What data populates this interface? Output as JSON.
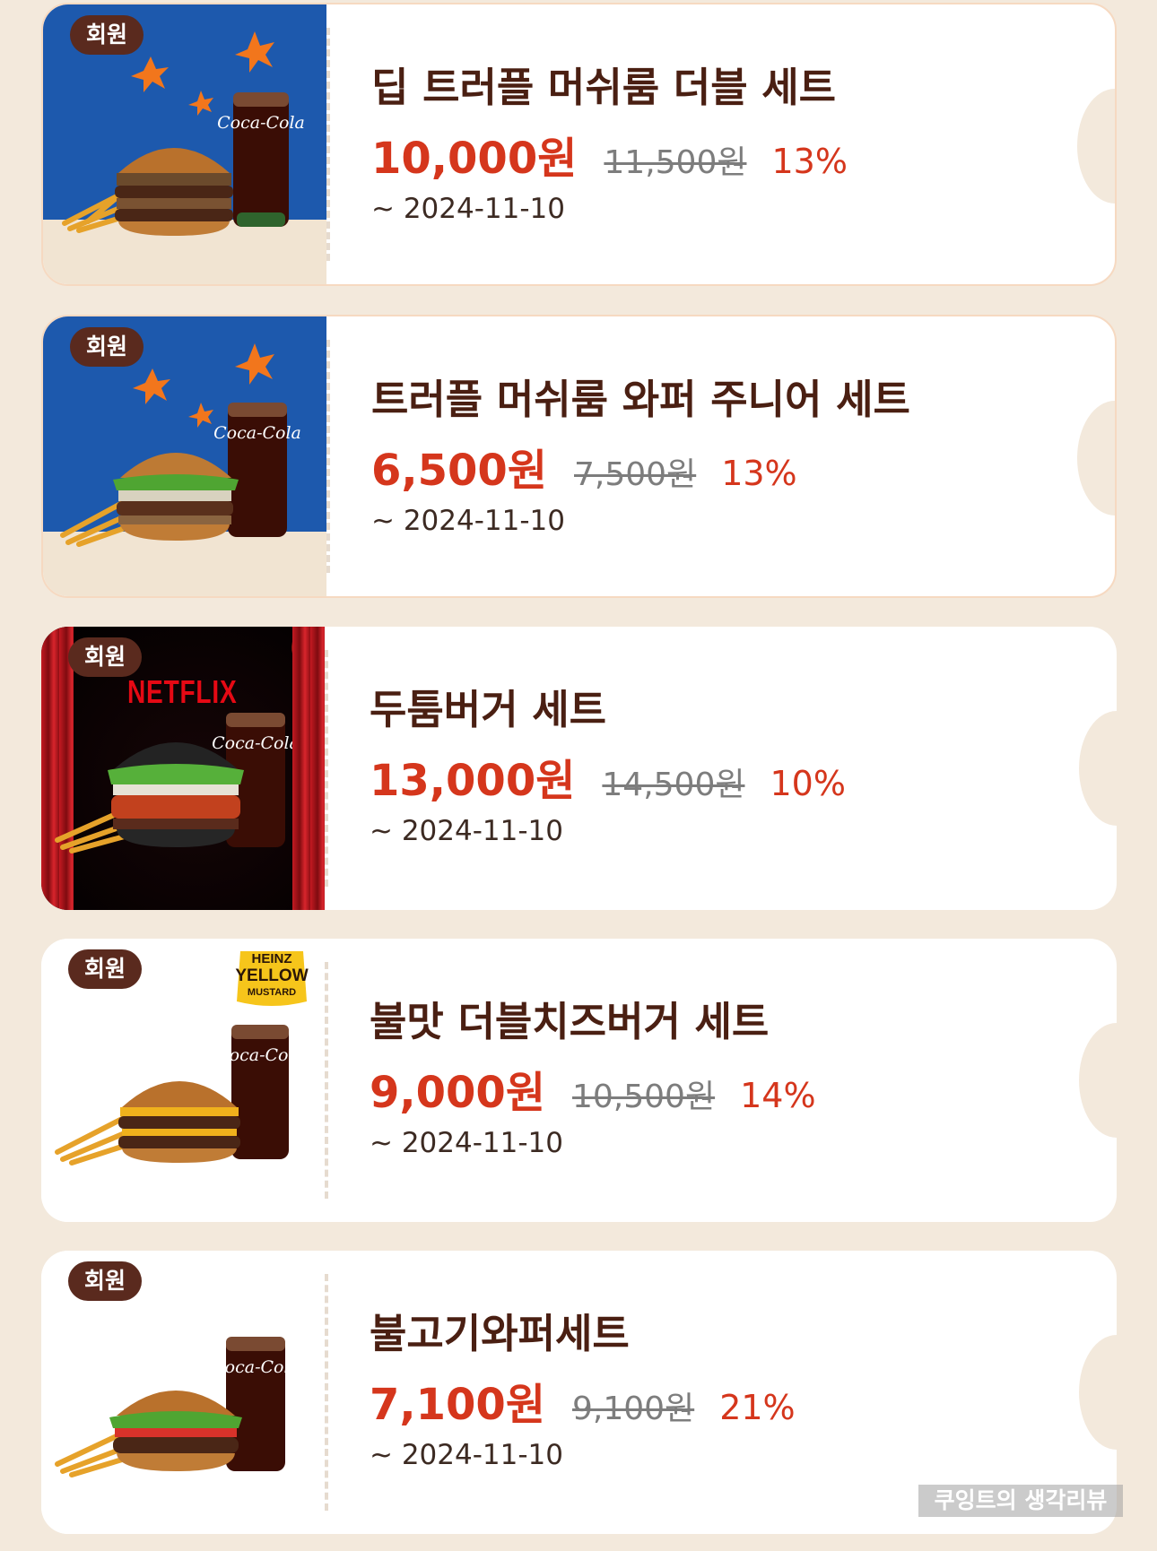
{
  "coupons": [
    {
      "badge": "회원",
      "name": "딥 트러플 머쉬룸 더블 세트",
      "price": "10,000원",
      "original_price": "11,500원",
      "discount": "13%",
      "expiry": "~ 2024-11-10",
      "image": "deep-truffle-double-set-photo"
    },
    {
      "badge": "회원",
      "name": "트러플 머쉬룸 와퍼 주니어 세트",
      "price": "6,500원",
      "original_price": "7,500원",
      "discount": "13%",
      "expiry": "~ 2024-11-10",
      "image": "truffle-whopper-junior-set-photo"
    },
    {
      "badge": "회원",
      "name": "두툼버거 세트",
      "price": "13,000원",
      "original_price": "14,500원",
      "discount": "10%",
      "expiry": "~ 2024-11-10",
      "image": "dutum-burger-set-photo",
      "brand_text": "NETFLIX"
    },
    {
      "badge": "회원",
      "name": "불맛 더블치즈버거 세트",
      "price": "9,000원",
      "original_price": "10,500원",
      "discount": "14%",
      "expiry": "~ 2024-11-10",
      "image": "fire-double-cheeseburger-set-photo",
      "brand_text": [
        "HEINZ",
        "YELLOW",
        "MUSTARD"
      ]
    },
    {
      "badge": "회원",
      "name": "불고기와퍼세트",
      "price": "7,100원",
      "original_price": "9,100원",
      "discount": "21%",
      "expiry": "~ 2024-11-10",
      "image": "bulgogi-whopper-set-photo"
    }
  ],
  "watermark": "쿠잉트의 생각리뷰",
  "colors": {
    "background": "#f3e9dc",
    "price": "#d5361c",
    "title": "#4a1f12",
    "badge": "#5a2a1e",
    "blue_panel": "#1d59ad"
  }
}
